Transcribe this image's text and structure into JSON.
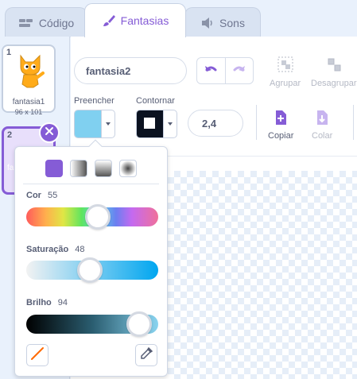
{
  "tabs": [
    {
      "label": "Código",
      "icon": "code-icon"
    },
    {
      "label": "Fantasias",
      "icon": "paintbrush-icon"
    },
    {
      "label": "Sons",
      "icon": "speaker-icon"
    }
  ],
  "costumes": [
    {
      "number": "1",
      "name": "fantasia1",
      "size": "96 x 101"
    },
    {
      "number": "2",
      "name": "fa"
    }
  ],
  "editor": {
    "costume_name": "fantasia2",
    "group_label": "Agrupar",
    "ungroup_label": "Desagrupar",
    "fill_label": "Preencher",
    "outline_label": "Contornar",
    "outline_width": "2,4",
    "copy_label": "Copiar",
    "paste_label": "Colar"
  },
  "colors": {
    "fill": "#80d0f0",
    "outline": "#0b1220",
    "accent": "#855cd6"
  },
  "color_picker": {
    "color_label": "Cor",
    "color_value": 55,
    "saturation_label": "Saturação",
    "saturation_value": 48,
    "brightness_label": "Brilho",
    "brightness_value": 94
  }
}
